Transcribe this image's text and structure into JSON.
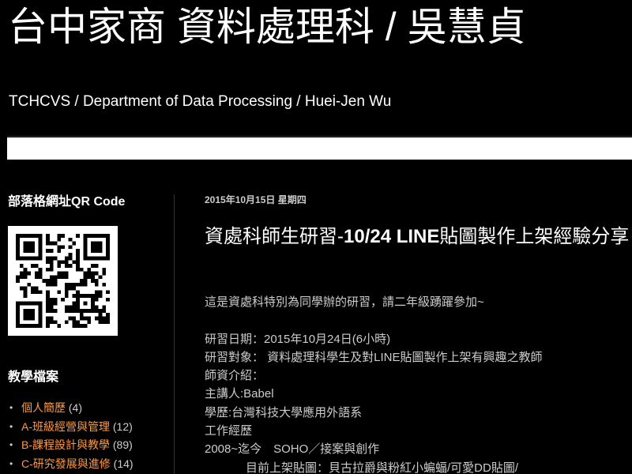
{
  "header": {
    "title": "台中家商 資料處理科 / 吳慧貞",
    "description": "TCHCVS / Department of Data Processing / Huei-Jen Wu"
  },
  "sidebar": {
    "qr_title": "部落格網址QR Code",
    "archive_title": "教學檔案",
    "archive_items": [
      {
        "label": "個人簡歷",
        "count": "(4)"
      },
      {
        "label": "A-班級經營與管理",
        "count": "(12)"
      },
      {
        "label": "B-課程設計與教學",
        "count": "(89)"
      },
      {
        "label": "C-研究發展與進修",
        "count": "(14)"
      }
    ]
  },
  "post": {
    "date": "2015年10月15日 星期四",
    "title_plain": "資處科師生研習-",
    "title_bold": "10/24 LINE",
    "title_rest": "貼圖製作上架經驗分享",
    "lines": {
      "intro": "這是資處科特別為同學辦的研習，請二年級踴躍參加~",
      "date_line": "研習日期：2015年10月24日(6小時)",
      "audience": "研習對象： 資料處理科學生及對LINE貼圖製作上架有興趣之教師",
      "speaker_intro": "師資介紹：",
      "speaker": "主講人:Babel",
      "education": "學歷:台灣科技大學應用外語系",
      "experience": "工作經歷",
      "job": "2008~迄今　SOHO／接案與創作",
      "stickers": "目前上架貼圖：貝古拉爵與粉紅小蝙蝠/可愛DD貼圖/"
    }
  },
  "colors": {
    "background": "#000000",
    "link": "#ff9933",
    "text": "#cccccc",
    "heading": "#ffffff"
  }
}
